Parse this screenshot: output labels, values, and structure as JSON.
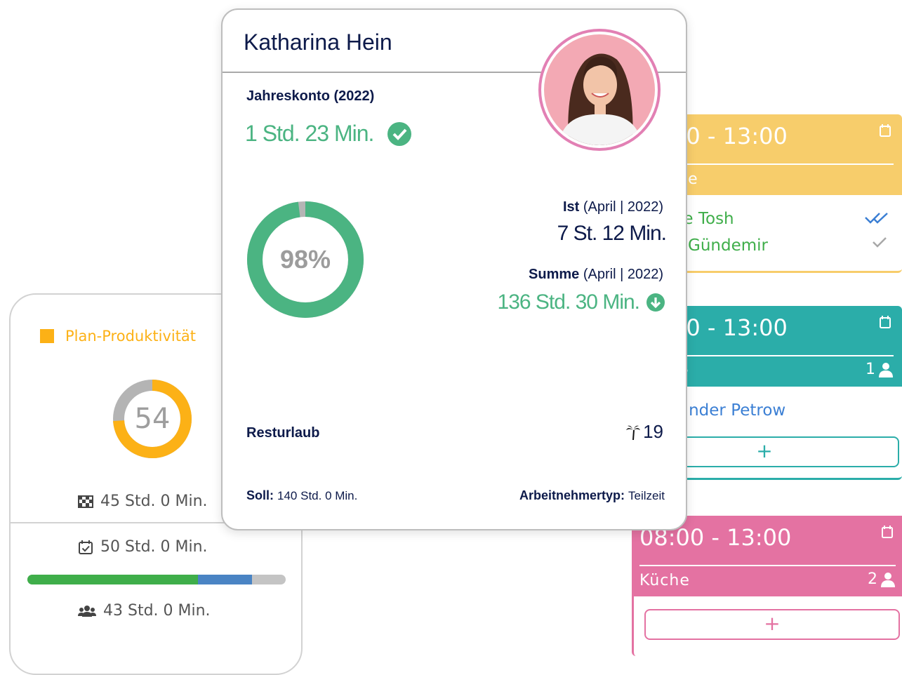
{
  "employee": {
    "name": "Katharina Hein",
    "annual_account_label": "Jahreskonto (2022)",
    "annual_account_value": "1 Std. 23 Min.",
    "donut_percent": 98,
    "donut_label": "98%",
    "actual_label_bold": "Ist",
    "actual_label_period": "(April | 2022)",
    "actual_value": "7 St. 12 Min.",
    "sum_label_bold": "Summe",
    "sum_label_period": "(April | 2022)",
    "sum_value": "136 Std. 30 Min.",
    "vacation_label": "Resturlaub",
    "vacation_value": "19",
    "target_label": "Soll:",
    "target_value": "140 Std. 0 Min.",
    "employee_type_label": "Arbeitnehmertyp:",
    "employee_type_value": "Teilzeit"
  },
  "productivity": {
    "legend_label": "Plan-Produktivität",
    "gauge_value": "54",
    "gauge_fraction": 0.74,
    "line1": "45 Std. 0 Min.",
    "line2": "50 Std. 0 Min.",
    "line3": "43 Std. 0 Min.",
    "progress_fractions": {
      "green": 0.66,
      "blue": 0.21,
      "gray": 0.13
    }
  },
  "shifts": [
    {
      "time": "00 - 13:00",
      "dept": "ce",
      "count": "",
      "color": "#f7cd6b",
      "staff": [
        {
          "name": "ie Tosh",
          "status": "double-check-icon"
        },
        {
          "name": "Gündemir",
          "status": "check-icon"
        }
      ]
    },
    {
      "time": "00 - 13:00",
      "dept": "e",
      "count": "1",
      "color": "#2bada9",
      "staff": [
        {
          "name": "ander Petrow"
        }
      ],
      "add": "+"
    },
    {
      "time": "08:00 - 13:00",
      "dept": "Küche",
      "count": "2",
      "color": "#e472a2",
      "staff": [],
      "add": "+"
    }
  ],
  "colors": {
    "green": "#4bb482",
    "navy": "#0d1a4a",
    "orange": "#fcb116",
    "yellow": "#f7cd6b",
    "teal": "#2bada9",
    "pink": "#e472a2"
  }
}
